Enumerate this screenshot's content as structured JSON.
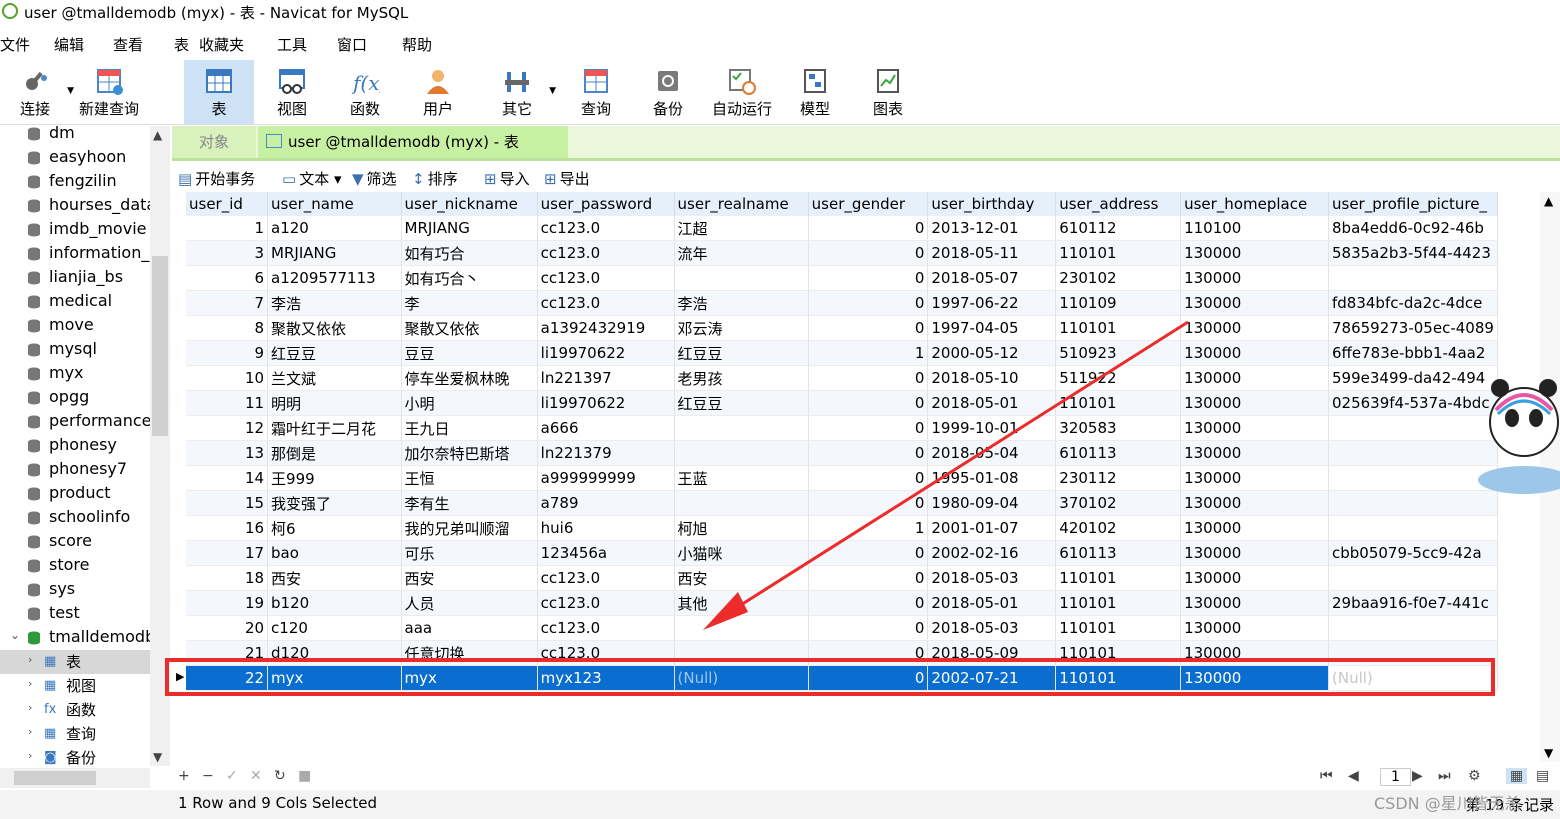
{
  "window": {
    "title": "user @tmalldemodb (myx) - 表 - Navicat for MySQL"
  },
  "menu": [
    "文件",
    "编辑",
    "查看",
    "表",
    "收藏夹",
    "工具",
    "窗口",
    "帮助"
  ],
  "toolbar": [
    "连接",
    "新建查询",
    "表",
    "视图",
    "函数",
    "用户",
    "其它",
    "查询",
    "备份",
    "自动运行",
    "模型",
    "图表"
  ],
  "sidebar": {
    "databases": [
      "dm",
      "easyhoon",
      "fengzilin",
      "hourses_data",
      "imdb_movie",
      "information_s",
      "lianjia_bs",
      "medical",
      "move",
      "mysql",
      "myx",
      "opgg",
      "performance_",
      "phonesy",
      "phonesy7",
      "product",
      "schoolinfo",
      "score",
      "store",
      "sys",
      "test",
      "tmalldemodb"
    ],
    "sub_items": [
      "表",
      "视图",
      "函数",
      "查询",
      "备份"
    ]
  },
  "tabs": {
    "objects": "对象",
    "active": "user @tmalldemodb (myx) - 表"
  },
  "subtoolbar": [
    "开始事务",
    "文本",
    "筛选",
    "排序",
    "导入",
    "导出"
  ],
  "grid": {
    "columns": [
      "user_id",
      "user_name",
      "user_nickname",
      "user_password",
      "user_realname",
      "user_gender",
      "user_birthday",
      "user_address",
      "user_homeplace",
      "user_profile_picture_"
    ],
    "rows": [
      [
        "1",
        "a120",
        "MRJIANG",
        "cc123.0",
        "江超",
        "0",
        "2013-12-01",
        "610112",
        "110100",
        "8ba4edd6-0c92-46b"
      ],
      [
        "3",
        "MRJIANG",
        "如有巧合",
        "cc123.0",
        "流年",
        "0",
        "2018-05-11",
        "110101",
        "130000",
        "5835a2b3-5f44-4423"
      ],
      [
        "6",
        "a1209577113",
        "如有巧合丶",
        "cc123.0",
        "",
        "0",
        "2018-05-07",
        "230102",
        "130000",
        ""
      ],
      [
        "7",
        "李浩",
        "李",
        "cc123.0",
        "李浩",
        "0",
        "1997-06-22",
        "110109",
        "130000",
        "fd834bfc-da2c-4dce"
      ],
      [
        "8",
        "聚散又依依",
        "聚散又依依",
        "a1392432919",
        "邓云涛",
        "0",
        "1997-04-05",
        "110101",
        "130000",
        "78659273-05ec-4089"
      ],
      [
        "9",
        "红豆豆",
        "豆豆",
        "li19970622",
        "红豆豆",
        "1",
        "2000-05-12",
        "510923",
        "130000",
        "6ffe783e-bbb1-4aa2"
      ],
      [
        "10",
        "兰文斌",
        "停车坐爱枫林晚",
        "ln221397",
        "老男孩",
        "0",
        "2018-05-10",
        "511922",
        "130000",
        "599e3499-da42-494"
      ],
      [
        "11",
        "明明",
        "小明",
        "li19970622",
        "红豆豆",
        "0",
        "2018-05-01",
        "110101",
        "130000",
        "025639f4-537a-4bdc"
      ],
      [
        "12",
        "霜叶红于二月花",
        "王九日",
        "a666",
        "",
        "0",
        "1999-10-01",
        "320583",
        "130000",
        ""
      ],
      [
        "13",
        "那倒是",
        "加尔奈特巴斯塔",
        "ln221379",
        "",
        "0",
        "2018-05-04",
        "610113",
        "130000",
        ""
      ],
      [
        "14",
        "王999",
        "王恒",
        "a999999999",
        "王蓝",
        "0",
        "1995-01-08",
        "230112",
        "130000",
        ""
      ],
      [
        "15",
        "我变强了",
        "李有生",
        "a789",
        "",
        "0",
        "1980-09-04",
        "370102",
        "130000",
        ""
      ],
      [
        "16",
        "柯6",
        "我的兄弟叫顺溜",
        "hui6",
        "柯旭",
        "1",
        "2001-01-07",
        "420102",
        "130000",
        ""
      ],
      [
        "17",
        "bao",
        "可乐",
        "123456a",
        "小猫咪",
        "0",
        "2002-02-16",
        "610113",
        "130000",
        "cbb05079-5cc9-42a"
      ],
      [
        "18",
        "西安",
        "西安",
        "cc123.0",
        "西安",
        "0",
        "2018-05-03",
        "110101",
        "130000",
        ""
      ],
      [
        "19",
        "b120",
        "人员",
        "cc123.0",
        "其他",
        "0",
        "2018-05-01",
        "110101",
        "130000",
        "29baa916-f0e7-441c"
      ],
      [
        "20",
        "c120",
        "aaa",
        "cc123.0",
        "",
        "0",
        "2018-05-03",
        "110101",
        "130000",
        ""
      ],
      [
        "21",
        "d120",
        "任意切换",
        "cc123.0",
        "",
        "0",
        "2018-05-09",
        "110101",
        "130000",
        ""
      ]
    ],
    "selected_row": [
      "22",
      "myx",
      "myx",
      "myx123",
      "(Null)",
      "0",
      "2002-07-21",
      "110101",
      "130000",
      "(Null)"
    ]
  },
  "pager": {
    "page": "1"
  },
  "status": {
    "left": "1 Row and 9 Cols Selected",
    "right": "第 19 条记录",
    "watermark": "CSDN @星川皆无恙"
  }
}
